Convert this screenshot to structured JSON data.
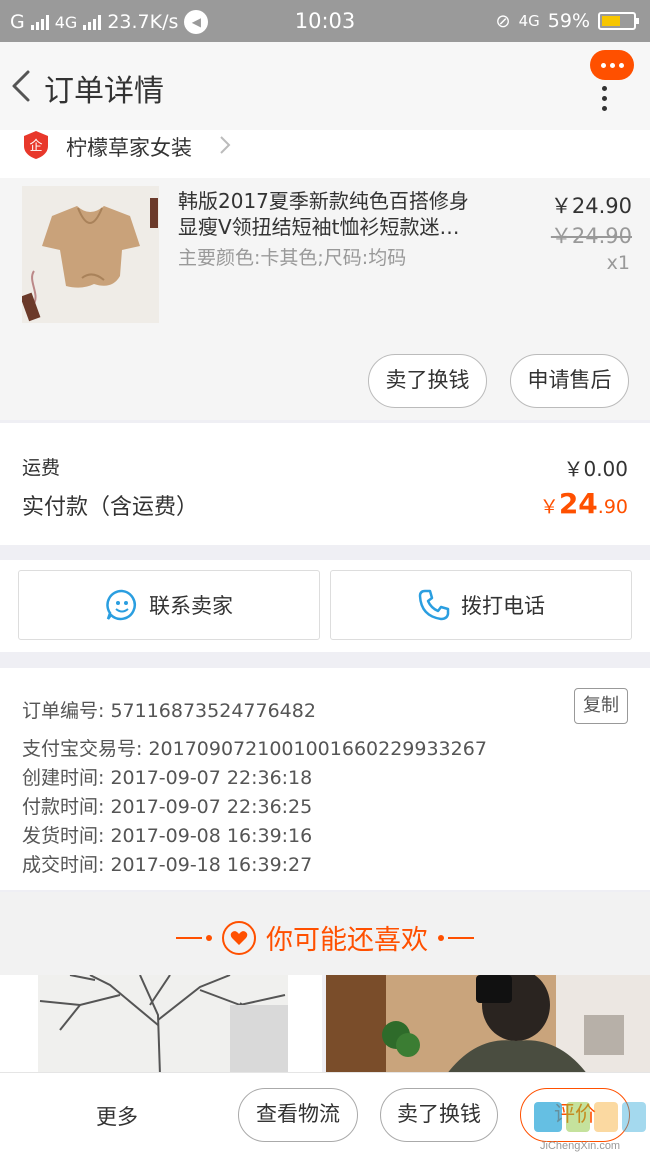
{
  "status_bar": {
    "carrier_left": "G",
    "network": "4G",
    "speed": "23.7K/s",
    "time": "10:03",
    "network_right": "4G",
    "battery": "59%"
  },
  "header": {
    "title": "订单详情"
  },
  "shop": {
    "name": "柠檬草家女装",
    "badge": "企"
  },
  "product": {
    "title_line1": "韩版2017夏季新款纯色百搭修身",
    "title_line2": "显瘦V领扭结短袖t恤衫短款迷…",
    "sku": "主要颜色:卡其色;尺码:均码",
    "price": "￥24.90",
    "original_price": "￥24.90",
    "quantity": "x1",
    "sell_button": "卖了换钱",
    "after_sale_button": "申请售后"
  },
  "fees": {
    "shipping_label": "运费",
    "shipping_value": "￥0.00",
    "paid_label": "实付款（含运费）",
    "paid_symbol": "￥",
    "paid_int": "24",
    "paid_dec": ".90"
  },
  "contact": {
    "seller_button": "联系卖家",
    "call_button": "拨打电话"
  },
  "order_info": {
    "order_no": "订单编号: 57116873524776482",
    "alipay_no": "支付宝交易号: 2017090721001001660229933267",
    "created": "创建时间: 2017-09-07 22:36:18",
    "paid": "付款时间: 2017-09-07 22:36:25",
    "shipped": "发货时间: 2017-09-08 16:39:16",
    "completed": "成交时间: 2017-09-18 16:39:27",
    "copy_button": "复制"
  },
  "recommend": {
    "title": "你可能还喜欢"
  },
  "bottom_bar": {
    "more": "更多",
    "logistics_button": "查看物流",
    "sell_button": "卖了换钱",
    "rate_button": "评价"
  },
  "watermark": {
    "text": "JiChengXin.com"
  },
  "colors": {
    "accent": "#ff5000",
    "status_bar": "#9a9a9a",
    "icon_blue": "#2a9ee0"
  },
  "icons": [
    "back-icon",
    "message-bubble-icon",
    "more-icon",
    "shop-badge-icon",
    "chevron-right-icon",
    "chat-icon",
    "phone-icon",
    "heart-icon"
  ]
}
